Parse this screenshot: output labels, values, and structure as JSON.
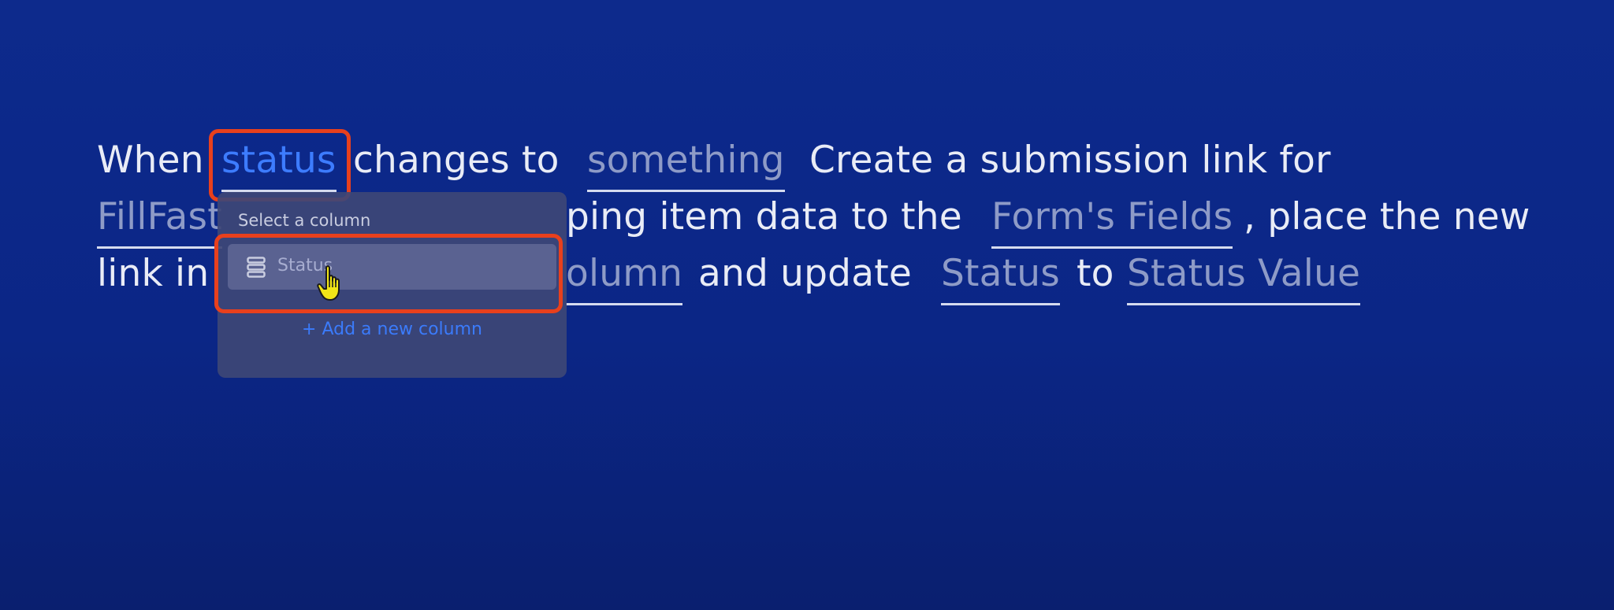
{
  "sentence": {
    "line1": {
      "when": "When",
      "trigger_column": "status",
      "changes_to": "changes to",
      "trigger_value": "something",
      "create_text": "Create a submission link for"
    },
    "line2": {
      "form_partial": "FillFast",
      "mapping_text": "ping item data to the",
      "form_fields": "Form's Fields",
      "place_text": ", place the new"
    },
    "line3": {
      "link_in": "link in",
      "column_partial": "olumn",
      "and_update": "and update",
      "status_column": "Status",
      "to": "to",
      "status_value": "Status Value"
    }
  },
  "dropdown": {
    "title": "Select a column",
    "items": [
      {
        "label": "Status",
        "icon": "column-list-icon"
      }
    ],
    "add_label": "+ Add a new column"
  },
  "colors": {
    "background": "#0d2a8c",
    "highlight": "#e8401d",
    "accent": "#3d7cff"
  }
}
